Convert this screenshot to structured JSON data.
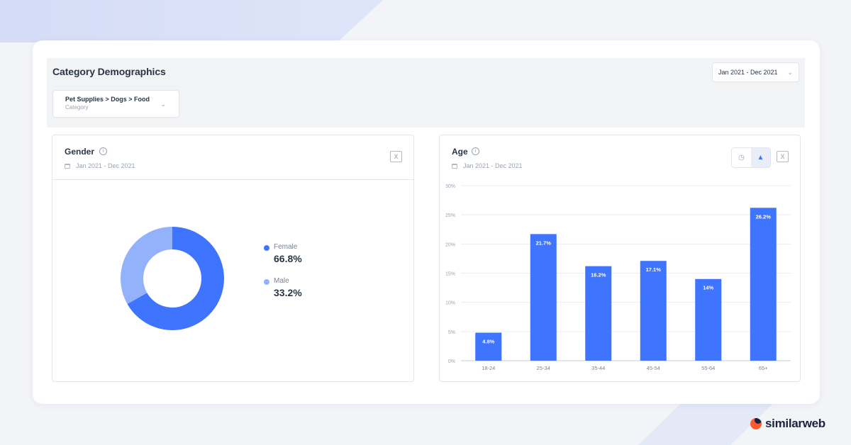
{
  "page": {
    "title": "Category Demographics"
  },
  "header": {
    "date_range": "Jan 2021 - Dec 2021",
    "category": {
      "value": "Pet Supplies > Dogs > Food",
      "label": "Category"
    }
  },
  "gender": {
    "title": "Gender",
    "date_range": "Jan 2021 - Dec 2021",
    "legend": [
      {
        "label": "Female",
        "value": "66.8%",
        "color": "#3e74fe"
      },
      {
        "label": "Male",
        "value": "33.2%",
        "color": "#94b2fc"
      }
    ]
  },
  "age": {
    "title": "Age",
    "date_range": "Jan 2021 - Dec 2021"
  },
  "brand": {
    "name": "similarweb"
  },
  "chart_data": [
    {
      "type": "pie",
      "categories": [
        "Female",
        "Male"
      ],
      "values": [
        66.8,
        33.2
      ],
      "colors": [
        "#3e74fe",
        "#94b2fc"
      ]
    },
    {
      "type": "bar",
      "categories": [
        "18-24",
        "25-34",
        "35-44",
        "45-54",
        "55-64",
        "65+"
      ],
      "values": [
        4.8,
        21.7,
        16.2,
        17.1,
        14,
        26.2
      ],
      "data_labels": [
        "4.8%",
        "21.7%",
        "16.2%",
        "17.1%",
        "14%",
        "26.2%"
      ],
      "ylim": [
        0,
        30
      ],
      "yticks": [
        "0%",
        "5%",
        "10%",
        "15%",
        "20%",
        "25%",
        "30%"
      ],
      "grid": true,
      "color": "#3e74fe"
    }
  ]
}
